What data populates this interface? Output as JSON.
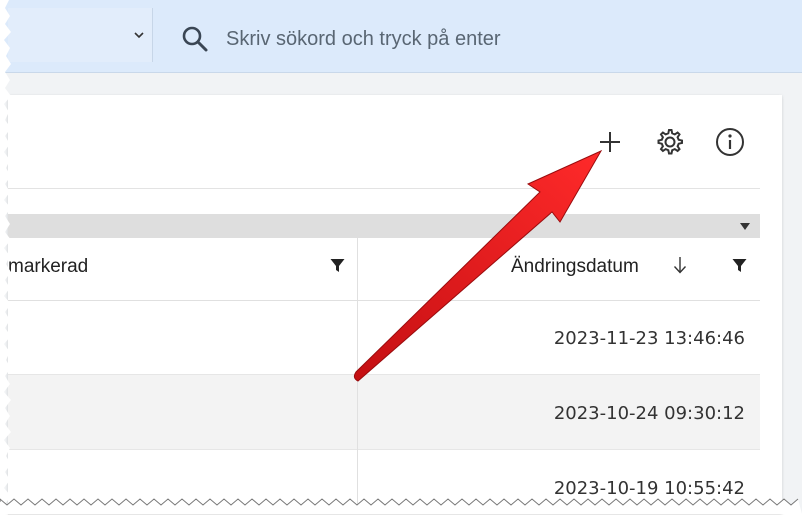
{
  "search": {
    "placeholder": "Skriv sökord och tryck på enter",
    "value": ""
  },
  "toolbar": {
    "icons": [
      "plus-icon",
      "gear-icon",
      "info-icon"
    ]
  },
  "table": {
    "columns": [
      {
        "label": "markerad"
      },
      {
        "label": "Ändringsdatum"
      }
    ],
    "rows": [
      {
        "date": "2023-11-23 13:46:46"
      },
      {
        "date": "2023-10-24 09:30:12"
      },
      {
        "date": "2023-10-19 10:55:42"
      }
    ]
  },
  "colors": {
    "topbar": "#dceafb",
    "arrow": "#e0191b"
  }
}
